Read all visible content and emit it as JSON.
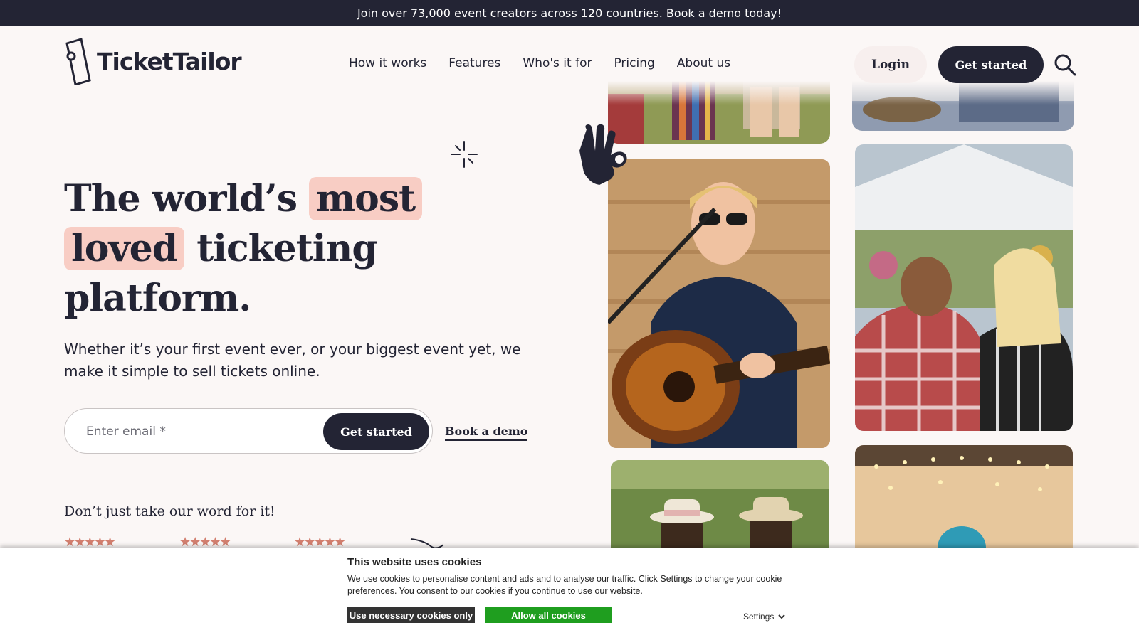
{
  "announcement": {
    "text": "Join over 73,000 event creators across 120 countries. Book a demo today!"
  },
  "header": {
    "logo_text": "TicketTailor",
    "nav": [
      "How it works",
      "Features",
      "Who's it for",
      "Pricing",
      "About us"
    ],
    "login_label": "Login",
    "get_started_label": "Get started",
    "search_icon": "search-icon"
  },
  "hero": {
    "title_part1": "The world’s ",
    "title_highlight1": "most",
    "title_highlight2": "loved",
    "title_part2": " ticketing platform.",
    "subtitle": "Whether it’s your first event ever, or your biggest event yet, we make it simple to sell tickets online.",
    "email_placeholder": "Enter email *",
    "form_button": "Get started",
    "demo_link": "Book a demo"
  },
  "reviews": {
    "title": "Don’t just take our word for it!",
    "ratings": [
      "★★★★★",
      "★★★★★",
      "★★★★★"
    ]
  },
  "colors": {
    "accent": "#232434",
    "highlight": "#f8cdc4",
    "star": "#d27f6f",
    "background": "#fbf7f6",
    "allow_green": "#1f9e1f"
  },
  "cookie": {
    "title": "This website uses cookies",
    "text": "We use cookies to personalise content and ads and to analyse our traffic. Click Settings to change your cookie preferences. You consent to our cookies if you continue to use our website.",
    "necessary_label": "Use necessary cookies only",
    "allow_label": "Allow all cookies",
    "settings_label": "Settings"
  }
}
